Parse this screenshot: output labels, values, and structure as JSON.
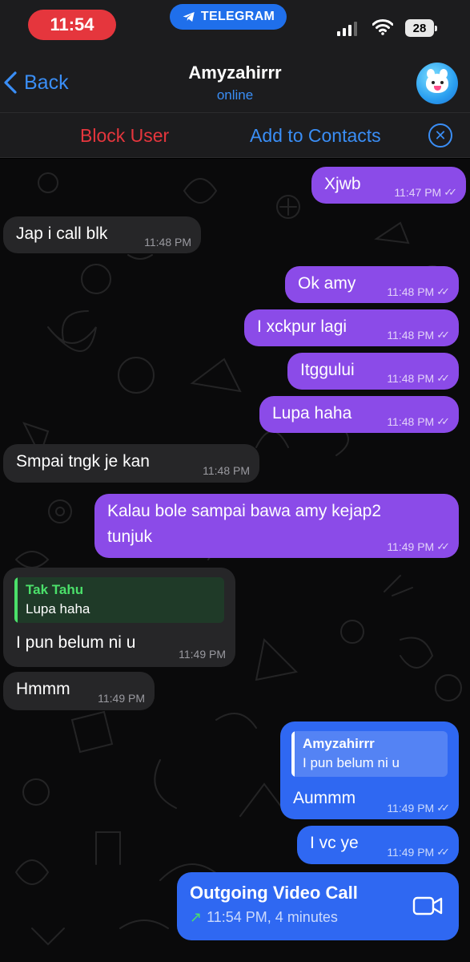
{
  "status_bar": {
    "time": "11:54",
    "app_pill": "TELEGRAM",
    "battery": "28"
  },
  "header": {
    "back_label": "Back",
    "contact_name": "Amyzahirrr",
    "status": "online"
  },
  "action_bar": {
    "block_label": "Block User",
    "add_label": "Add to Contacts"
  },
  "messages": [
    {
      "dir": "out",
      "text": "Xjwb",
      "time": "11:47 PM"
    },
    {
      "dir": "in",
      "text": "Jap i call blk",
      "time": "11:48 PM"
    },
    {
      "dir": "out",
      "text": "Ok amy",
      "time": "11:48 PM"
    },
    {
      "dir": "out",
      "text": "I xckpur lagi",
      "time": "11:48 PM"
    },
    {
      "dir": "out",
      "text": "Itggului",
      "time": "11:48 PM"
    },
    {
      "dir": "out",
      "text": "Lupa haha",
      "time": "11:48 PM"
    },
    {
      "dir": "in",
      "text": "Smpai tngk je kan",
      "time": "11:48 PM"
    },
    {
      "dir": "out",
      "line1": "Kalau bole sampai bawa amy kejap2",
      "line2": "tunjuk",
      "time": "11:49 PM"
    },
    {
      "dir": "in",
      "reply_name": "Tak Tahu",
      "reply_text": "Lupa haha",
      "text": "I pun belum ni u",
      "time": "11:49 PM"
    },
    {
      "dir": "in",
      "text": "Hmmm",
      "time": "11:49 PM"
    },
    {
      "dir": "out",
      "reply_name": "Amyzahirrr",
      "reply_text": "I pun belum ni u",
      "text": "Aummm",
      "time": "11:49 PM"
    },
    {
      "dir": "out",
      "text": "I vc ye",
      "time": "11:49 PM"
    }
  ],
  "call": {
    "title": "Outgoing Video Call",
    "detail": "11:54 PM, 4 minutes"
  },
  "colors": {
    "out_purple": "#8b4be8",
    "out_blue": "#2f68f2",
    "incoming": "#262628",
    "accent": "#3a8ef6",
    "danger": "#e5363d",
    "reply_green": "#4be06a"
  }
}
